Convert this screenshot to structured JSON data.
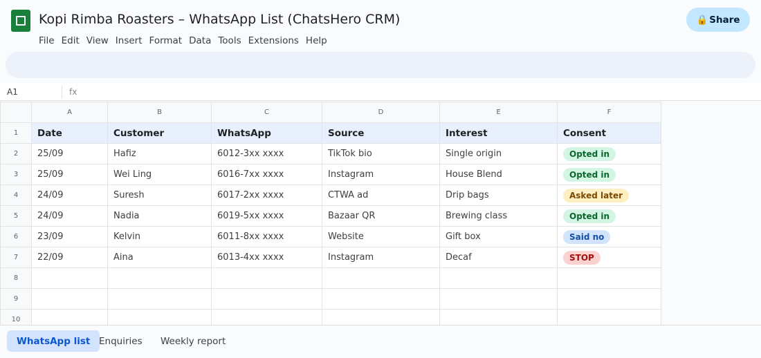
{
  "app": {
    "title": "Kopi Rimba Roasters – WhatsApp List (ChatsHero CRM)",
    "share_label": "Share",
    "share_icon": "🔒",
    "menu": [
      "File",
      "Edit",
      "View",
      "Insert",
      "Format",
      "Data",
      "Tools",
      "Extensions",
      "Help"
    ]
  },
  "formula_bar": {
    "cell_ref": "A1",
    "fx_label": "fx"
  },
  "sheet": {
    "columns": [
      "A",
      "B",
      "C",
      "D",
      "E",
      "F"
    ],
    "header_row": [
      "Date",
      "Customer",
      "WhatsApp",
      "Source",
      "Interest",
      "Consent"
    ],
    "rows": [
      {
        "date": "25/09",
        "customer": "Hafiz",
        "whatsapp": "6012-3xx xxxx",
        "source": "TikTok bio",
        "interest": "Single origin",
        "consent": "Opted in",
        "consent_color": "green"
      },
      {
        "date": "25/09",
        "customer": "Wei Ling",
        "whatsapp": "6016-7xx xxxx",
        "source": "Instagram",
        "interest": "House Blend",
        "consent": "Opted in",
        "consent_color": "green"
      },
      {
        "date": "24/09",
        "customer": "Suresh",
        "whatsapp": "6017-2xx xxxx",
        "source": "CTWA ad",
        "interest": "Drip bags",
        "consent": "Asked later",
        "consent_color": "yellow"
      },
      {
        "date": "24/09",
        "customer": "Nadia",
        "whatsapp": "6019-5xx xxxx",
        "source": "Bazaar QR",
        "interest": "Brewing class",
        "consent": "Opted in",
        "consent_color": "green"
      },
      {
        "date": "23/09",
        "customer": "Kelvin",
        "whatsapp": "6011-8xx xxxx",
        "source": "Website",
        "interest": "Gift box",
        "consent": "Said no",
        "consent_color": "blue"
      },
      {
        "date": "22/09",
        "customer": "Aina",
        "whatsapp": "6013-4xx xxxx",
        "source": "Instagram",
        "interest": "Decaf",
        "consent": "STOP",
        "consent_color": "red"
      }
    ],
    "row_numbers": [
      "1",
      "2",
      "3",
      "4",
      "5",
      "6",
      "7",
      "8",
      "9",
      "10"
    ]
  },
  "tabs": [
    {
      "label": "WhatsApp list",
      "active": true
    },
    {
      "label": "Enquiries",
      "active": false
    },
    {
      "label": "Weekly report",
      "active": false
    }
  ],
  "colors": {
    "brand": "#188038",
    "accent": "#0b57d0",
    "share_bg": "#c2e7ff"
  }
}
